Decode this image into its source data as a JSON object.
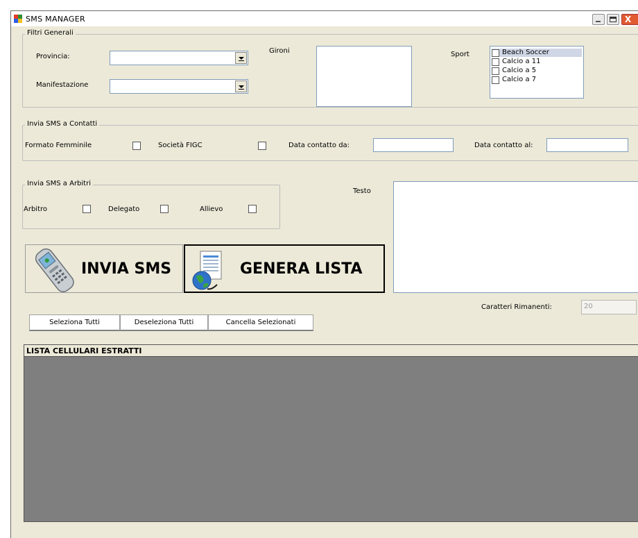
{
  "window": {
    "title": "SMS MANAGER"
  },
  "filters": {
    "legend": "Filtri Generali",
    "province_label": "Provincia:",
    "province_value": "",
    "event_label": "Manifestazione",
    "event_value": "",
    "gironi_label": "Gironi",
    "sport_label": "Sport",
    "sport_options": [
      {
        "label": "Beach Soccer",
        "checked": false,
        "selected": true
      },
      {
        "label": "Calcio a 11",
        "checked": false,
        "selected": false
      },
      {
        "label": "Calcio a 5",
        "checked": false,
        "selected": false
      },
      {
        "label": "Calcio a 7",
        "checked": false,
        "selected": false
      }
    ]
  },
  "contacts": {
    "legend": "Invia SMS a Contatti",
    "female_label": "Formato Femminile",
    "figc_label": "Società FIGC",
    "date_from_label": "Data contatto da:",
    "date_from_value": "",
    "date_to_label": "Data contatto al:",
    "date_to_value": ""
  },
  "referees": {
    "legend": "Invia SMS a Arbitri",
    "arbitro_label": "Arbitro",
    "delegato_label": "Delegato",
    "allievo_label": "Allievo"
  },
  "message": {
    "text_label": "Testo",
    "text_value": "",
    "remaining_label": "Caratteri Rimanenti:",
    "remaining_value": "20"
  },
  "actions": {
    "send_sms_label": "INVIA SMS",
    "generate_list_label": "GENERA LISTA",
    "select_all_label": "Seleziona Tutti",
    "deselect_all_label": "Deseleziona Tutti",
    "delete_selected_label": "Cancella Selezionati"
  },
  "list": {
    "header": "LISTA CELLULARI ESTRATTI"
  },
  "colors": {
    "window_bg": "#ece9d8",
    "grid_bg": "#7f7f7f",
    "selection_bg": "#cfd6e5",
    "close_button": "#e05a32"
  }
}
